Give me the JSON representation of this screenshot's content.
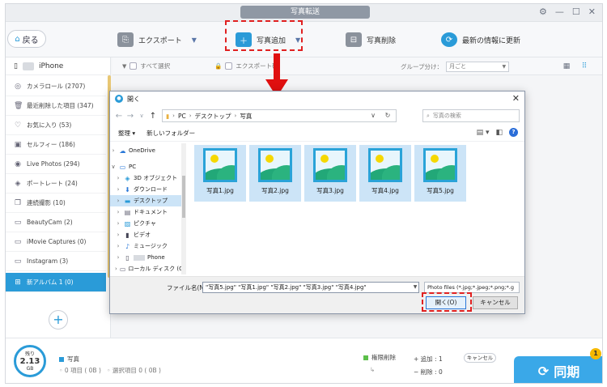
{
  "window": {
    "title": "写真転送"
  },
  "toolbar": {
    "back_label": "戻る",
    "export_label": "エクスポート",
    "add_label": "写真追加",
    "delete_label": "写真削除",
    "refresh_label": "最新の情報に更新"
  },
  "sidebar": {
    "device_name": "iPhone",
    "items": [
      {
        "label": "カメラロール (2707)",
        "icon": "camera-icon"
      },
      {
        "label": "最近削除した項目 (347)",
        "icon": "trash-icon"
      },
      {
        "label": "お気に入り (53)",
        "icon": "heart-icon"
      },
      {
        "label": "セルフィー (186)",
        "icon": "selfie-icon"
      },
      {
        "label": "Live Photos (294)",
        "icon": "live-icon"
      },
      {
        "label": "ポートレート (24)",
        "icon": "cube-icon"
      },
      {
        "label": "連続撮影 (10)",
        "icon": "burst-icon"
      },
      {
        "label": "BeautyCam (2)",
        "icon": "album-icon"
      },
      {
        "label": "iMovie Captures (0)",
        "icon": "album-icon"
      },
      {
        "label": "Instagram (3)",
        "icon": "album-icon"
      },
      {
        "label": "新アルバム 1 (0)",
        "icon": "new-album-icon"
      }
    ]
  },
  "filterbar": {
    "select_all": "すべて選択",
    "export_label": "エクスポート確",
    "group_label": "グループ分け：",
    "group_value": "月ごと"
  },
  "dialog": {
    "title": "開く",
    "path": [
      "PC",
      "デスクトップ",
      "写真"
    ],
    "search_placeholder": "写真の検索",
    "organize": "整理",
    "new_folder": "新しいフォルダー",
    "tree": [
      {
        "label": "OneDrive",
        "icon": "cloud-icon"
      },
      {
        "label": "PC",
        "icon": "pc-icon"
      },
      {
        "label": "3D オブジェクト",
        "icon": "cube-icon"
      },
      {
        "label": "ダウンロード",
        "icon": "download-icon"
      },
      {
        "label": "デスクトップ",
        "icon": "desktop-icon"
      },
      {
        "label": "ドキュメント",
        "icon": "document-icon"
      },
      {
        "label": "ピクチャ",
        "icon": "picture-icon"
      },
      {
        "label": "ビデオ",
        "icon": "video-icon"
      },
      {
        "label": "ミュージック",
        "icon": "music-icon"
      },
      {
        "label": "Phone",
        "icon": "phone-icon"
      },
      {
        "label": "ローカル ディスク (C",
        "icon": "disk-icon"
      }
    ],
    "files": [
      "写真1.jpg",
      "写真2.jpg",
      "写真3.jpg",
      "写真4.jpg",
      "写真5.jpg"
    ],
    "filename_label": "ファイル名(N):",
    "filename_value": "\"写真5.jpg\" \"写真1.jpg\" \"写真2.jpg\" \"写真3.jpg\" \"写真4.jpg\"",
    "filetype_value": "Photo files (*.jpg;*.jpeg;*.png;*.g",
    "open_button": "開く(O)",
    "cancel_button": "キャンセル"
  },
  "bottom": {
    "storage_top": "残り",
    "storage_value": "2.13",
    "storage_unit": "GB",
    "photo_label": "写真",
    "items_text": "0 項目 ( 0B )",
    "selected_text": "選択項目 0 ( 0B )",
    "perm_delete": "権限削除",
    "added_text": "追加 : 1",
    "deleted_text": "削除 : 0",
    "cancel_label": "キャンセル",
    "sync_label": "同期",
    "badge_count": "1"
  },
  "colors": {
    "accent": "#2a9bd8",
    "highlight_red": "#e02020",
    "sync_blue": "#3aa8e8",
    "badge_yellow": "#f5b800"
  }
}
